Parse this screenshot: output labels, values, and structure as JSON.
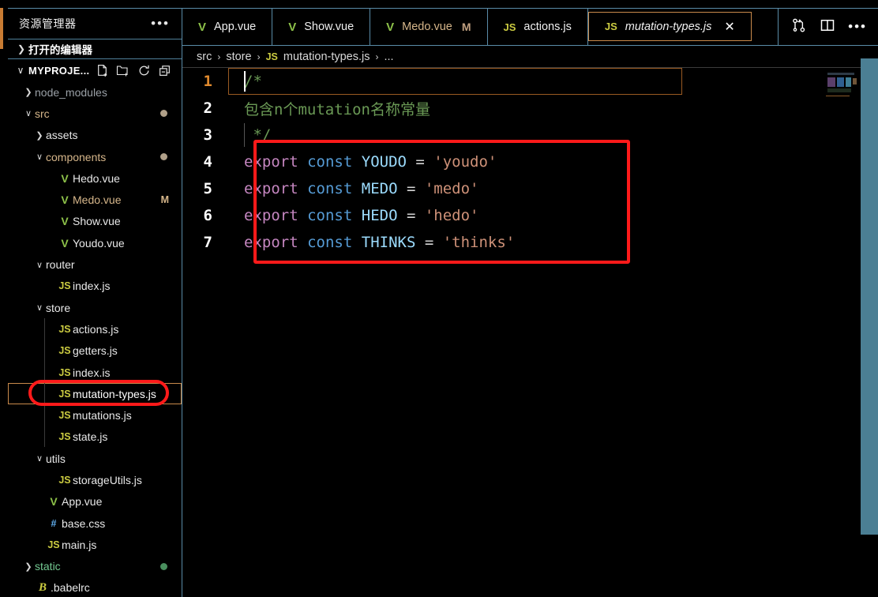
{
  "sidebar": {
    "title": "资源管理器",
    "more_label": "•••",
    "open_editors": {
      "label": "打开的编辑器",
      "twisty": "❯"
    },
    "project": {
      "name": "MYPROJE...",
      "twisty": "∨",
      "actions": [
        "new-file",
        "new-folder",
        "refresh",
        "collapse-all"
      ]
    },
    "tree": [
      {
        "label": "node_modules",
        "type": "folder",
        "state": "collapsed",
        "depth": 1,
        "icon": "",
        "color": "#9aa0a6",
        "badge": "",
        "dot": ""
      },
      {
        "label": "src",
        "type": "folder",
        "state": "expanded",
        "depth": 1,
        "icon": "",
        "color": "#d6b68a",
        "badge": "",
        "dot": "#b0a089"
      },
      {
        "label": "assets",
        "type": "folder",
        "state": "collapsed",
        "depth": 2,
        "icon": "",
        "color": "#e8e8e8",
        "badge": "",
        "dot": ""
      },
      {
        "label": "components",
        "type": "folder",
        "state": "expanded",
        "depth": 2,
        "icon": "",
        "color": "#d6b68a",
        "badge": "",
        "dot": "#b0a089"
      },
      {
        "label": "Hedo.vue",
        "type": "file",
        "state": "",
        "depth": 3,
        "icon": "V",
        "iconColor": "#8dc149",
        "color": "#e8e8e8",
        "badge": "",
        "dot": ""
      },
      {
        "label": "Medo.vue",
        "type": "file",
        "state": "",
        "depth": 3,
        "icon": "V",
        "iconColor": "#8dc149",
        "color": "#d6b68a",
        "badge": "M",
        "badgeColor": "#d6b68a",
        "dot": ""
      },
      {
        "label": "Show.vue",
        "type": "file",
        "state": "",
        "depth": 3,
        "icon": "V",
        "iconColor": "#8dc149",
        "color": "#e8e8e8",
        "badge": "",
        "dot": ""
      },
      {
        "label": "Youdo.vue",
        "type": "file",
        "state": "",
        "depth": 3,
        "icon": "V",
        "iconColor": "#8dc149",
        "color": "#e8e8e8",
        "badge": "",
        "dot": ""
      },
      {
        "label": "router",
        "type": "folder",
        "state": "expanded",
        "depth": 2,
        "icon": "",
        "color": "#e8e8e8",
        "badge": "",
        "dot": ""
      },
      {
        "label": "index.js",
        "type": "file",
        "state": "",
        "depth": 3,
        "icon": "JS",
        "iconColor": "#cbcb41",
        "color": "#e8e8e8",
        "badge": "",
        "dot": ""
      },
      {
        "label": "store",
        "type": "folder",
        "state": "expanded",
        "depth": 2,
        "icon": "",
        "color": "#e8e8e8",
        "badge": "",
        "dot": ""
      },
      {
        "label": "actions.js",
        "type": "file",
        "state": "",
        "depth": 3,
        "icon": "JS",
        "iconColor": "#cbcb41",
        "color": "#e8e8e8",
        "badge": "",
        "dot": ""
      },
      {
        "label": "getters.js",
        "type": "file",
        "state": "",
        "depth": 3,
        "icon": "JS",
        "iconColor": "#cbcb41",
        "color": "#e8e8e8",
        "badge": "",
        "dot": ""
      },
      {
        "label": "index.is",
        "type": "file",
        "state": "",
        "depth": 3,
        "icon": "JS",
        "iconColor": "#cbcb41",
        "color": "#e8e8e8",
        "badge": "",
        "dot": ""
      },
      {
        "label": "mutation-types.js",
        "type": "file",
        "state": "selected",
        "depth": 3,
        "icon": "JS",
        "iconColor": "#cbcb41",
        "color": "#ffffff",
        "badge": "",
        "dot": ""
      },
      {
        "label": "mutations.js",
        "type": "file",
        "state": "",
        "depth": 3,
        "icon": "JS",
        "iconColor": "#cbcb41",
        "color": "#e8e8e8",
        "badge": "",
        "dot": ""
      },
      {
        "label": "state.js",
        "type": "file",
        "state": "",
        "depth": 3,
        "icon": "JS",
        "iconColor": "#cbcb41",
        "color": "#e8e8e8",
        "badge": "",
        "dot": ""
      },
      {
        "label": "utils",
        "type": "folder",
        "state": "expanded",
        "depth": 2,
        "icon": "",
        "color": "#e8e8e8",
        "badge": "",
        "dot": ""
      },
      {
        "label": "storageUtils.js",
        "type": "file",
        "state": "",
        "depth": 3,
        "icon": "JS",
        "iconColor": "#cbcb41",
        "color": "#e8e8e8",
        "badge": "",
        "dot": ""
      },
      {
        "label": "App.vue",
        "type": "file",
        "state": "",
        "depth": 2,
        "icon": "V",
        "iconColor": "#8dc149",
        "color": "#e8e8e8",
        "badge": "",
        "dot": ""
      },
      {
        "label": "base.css",
        "type": "file",
        "state": "",
        "depth": 2,
        "icon": "#",
        "iconColor": "#61afef",
        "color": "#e8e8e8",
        "badge": "",
        "dot": ""
      },
      {
        "label": "main.js",
        "type": "file",
        "state": "",
        "depth": 2,
        "icon": "JS",
        "iconColor": "#cbcb41",
        "color": "#e8e8e8",
        "badge": "",
        "dot": ""
      },
      {
        "label": "static",
        "type": "folder",
        "state": "collapsed",
        "depth": 1,
        "icon": "",
        "color": "#73c991",
        "badge": "",
        "dot": "#4a8f5e"
      },
      {
        "label": ".babelrc",
        "type": "file",
        "state": "",
        "depth": 1,
        "icon": "B",
        "iconColor": "#cbcb41",
        "color": "#e8e8e8",
        "badge": "",
        "dot": ""
      }
    ]
  },
  "tabs": [
    {
      "label": "App.vue",
      "icon": "V",
      "iconColor": "#8dc149",
      "active": false,
      "modified": "",
      "color": "#f0f0f0"
    },
    {
      "label": "Show.vue",
      "icon": "V",
      "iconColor": "#8dc149",
      "active": false,
      "modified": "",
      "color": "#f0f0f0"
    },
    {
      "label": "Medo.vue",
      "icon": "V",
      "iconColor": "#8dc149",
      "active": false,
      "modified": "M",
      "color": "#d6b68a"
    },
    {
      "label": "actions.js",
      "icon": "JS",
      "iconColor": "#cbcb41",
      "active": false,
      "modified": "",
      "color": "#f0f0f0"
    },
    {
      "label": "mutation-types.js",
      "icon": "JS",
      "iconColor": "#cbcb41",
      "active": true,
      "modified": "",
      "color": "#f0f0f0",
      "close": "✕"
    }
  ],
  "tab_actions": [
    {
      "name": "compare-changes-icon"
    },
    {
      "name": "split-editor-icon"
    },
    {
      "name": "more-actions-icon",
      "label": "•••"
    }
  ],
  "breadcrumb": {
    "items": [
      "src",
      "store",
      "mutation-types.js",
      "..."
    ],
    "separator": "›",
    "file_icon": "JS"
  },
  "editor": {
    "active_line": 1,
    "lines": [
      {
        "n": 1,
        "tokens": [
          {
            "t": "/*",
            "c": "cmt"
          }
        ]
      },
      {
        "n": 2,
        "tokens": [
          {
            "t": "包含n个mutation名称常量",
            "c": "cmt"
          }
        ]
      },
      {
        "n": 3,
        "tokens": [
          {
            "t": " */",
            "c": "cmt"
          }
        ]
      },
      {
        "n": 4,
        "tokens": [
          {
            "t": "export",
            "c": "kw-export"
          },
          {
            "t": " ",
            "c": "op"
          },
          {
            "t": "const",
            "c": "kw-const"
          },
          {
            "t": " ",
            "c": "op"
          },
          {
            "t": "YOUDO",
            "c": "ident"
          },
          {
            "t": " = ",
            "c": "op"
          },
          {
            "t": "'youdo'",
            "c": "str"
          }
        ]
      },
      {
        "n": 5,
        "tokens": [
          {
            "t": "export",
            "c": "kw-export"
          },
          {
            "t": " ",
            "c": "op"
          },
          {
            "t": "const",
            "c": "kw-const"
          },
          {
            "t": " ",
            "c": "op"
          },
          {
            "t": "MEDO",
            "c": "ident"
          },
          {
            "t": " = ",
            "c": "op"
          },
          {
            "t": "'medo'",
            "c": "str"
          }
        ]
      },
      {
        "n": 6,
        "tokens": [
          {
            "t": "export",
            "c": "kw-export"
          },
          {
            "t": " ",
            "c": "op"
          },
          {
            "t": "const",
            "c": "kw-const"
          },
          {
            "t": " ",
            "c": "op"
          },
          {
            "t": "HEDO",
            "c": "ident"
          },
          {
            "t": " = ",
            "c": "op"
          },
          {
            "t": "'hedo'",
            "c": "str"
          }
        ]
      },
      {
        "n": 7,
        "tokens": [
          {
            "t": "export",
            "c": "kw-export"
          },
          {
            "t": " ",
            "c": "op"
          },
          {
            "t": "const",
            "c": "kw-const"
          },
          {
            "t": " ",
            "c": "op"
          },
          {
            "t": "THINKS",
            "c": "ident"
          },
          {
            "t": " = ",
            "c": "op"
          },
          {
            "t": "'thinks'",
            "c": "str"
          }
        ]
      }
    ]
  },
  "annotations": [
    {
      "name": "code-highlight-box",
      "color": "#ff1a1a"
    },
    {
      "name": "file-highlight-box",
      "color": "#ff1a1a"
    }
  ],
  "colors": {
    "background": "#000000",
    "accent_orange": "#c98a4b",
    "border_blue": "#5a8ca8",
    "scrollbar": "#4b7f94",
    "annotation_red": "#ff1a1a"
  }
}
